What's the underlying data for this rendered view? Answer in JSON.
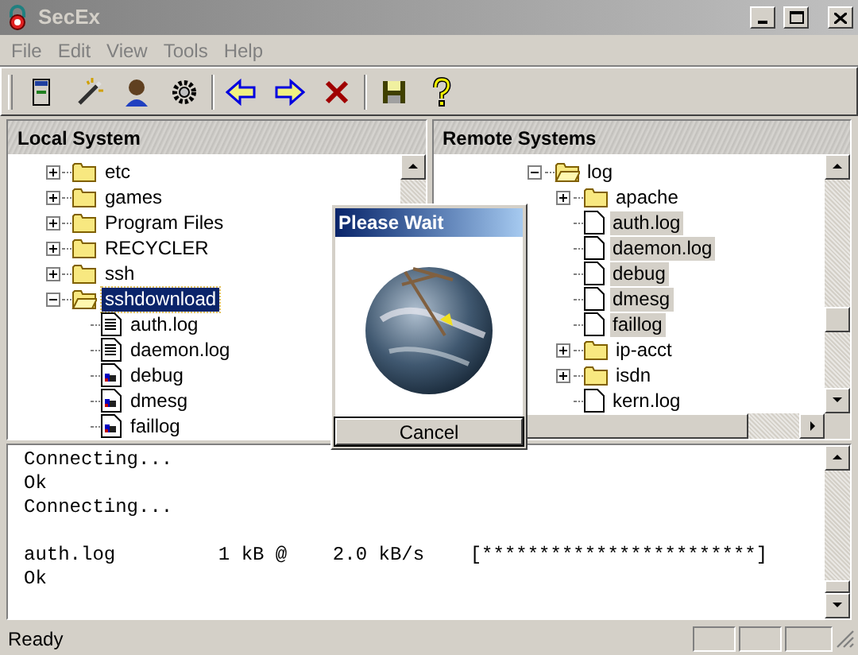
{
  "window": {
    "title": "SecEx"
  },
  "menu": [
    "File",
    "Edit",
    "View",
    "Tools",
    "Help"
  ],
  "local": {
    "title": "Local System",
    "focused": true,
    "tree": [
      {
        "label": "etc",
        "kind": "folder",
        "expanded": false,
        "selected": false
      },
      {
        "label": "games",
        "kind": "folder",
        "expanded": false,
        "selected": false
      },
      {
        "label": "Program Files",
        "kind": "folder",
        "expanded": false,
        "selected": false
      },
      {
        "label": "RECYCLER",
        "kind": "folder",
        "expanded": false,
        "selected": false
      },
      {
        "label": "ssh",
        "kind": "folder",
        "expanded": false,
        "selected": false
      },
      {
        "label": "sshdownload",
        "kind": "folder",
        "expanded": true,
        "selected": true,
        "children": [
          {
            "label": "auth.log",
            "kind": "text",
            "selected": false
          },
          {
            "label": "daemon.log",
            "kind": "text",
            "selected": false
          },
          {
            "label": "debug",
            "kind": "binary",
            "selected": false
          },
          {
            "label": "dmesg",
            "kind": "binary",
            "selected": false
          },
          {
            "label": "faillog",
            "kind": "binary",
            "selected": false
          }
        ]
      }
    ]
  },
  "remote": {
    "title": "Remote Systems",
    "focused": false,
    "tree": [
      {
        "label": "log",
        "kind": "folder",
        "expanded": true,
        "selected": false,
        "children": [
          {
            "label": "apache",
            "kind": "folder",
            "expanded": false,
            "selected": false
          },
          {
            "label": "auth.log",
            "kind": "file",
            "selected": true
          },
          {
            "label": "daemon.log",
            "kind": "file",
            "selected": true
          },
          {
            "label": "debug",
            "kind": "file",
            "selected": true
          },
          {
            "label": "dmesg",
            "kind": "file",
            "selected": true
          },
          {
            "label": "faillog",
            "kind": "file",
            "selected": true
          },
          {
            "label": "ip-acct",
            "kind": "folder",
            "expanded": false,
            "selected": false
          },
          {
            "label": "isdn",
            "kind": "folder",
            "expanded": false,
            "selected": false
          },
          {
            "label": "kern.log",
            "kind": "file",
            "selected": false
          }
        ]
      }
    ]
  },
  "dialog": {
    "title": "Please Wait",
    "button": "Cancel"
  },
  "console": [
    {
      "kind": "text",
      "text": "Connecting..."
    },
    {
      "kind": "text",
      "text": "Ok"
    },
    {
      "kind": "text",
      "text": "Connecting..."
    },
    {
      "kind": "blank"
    },
    {
      "kind": "text",
      "text": "auth.log         1 kB @    2.0 kB/s    [************************]"
    },
    {
      "kind": "text",
      "text": "Ok"
    }
  ],
  "status_bar": {
    "text": "Ready"
  }
}
